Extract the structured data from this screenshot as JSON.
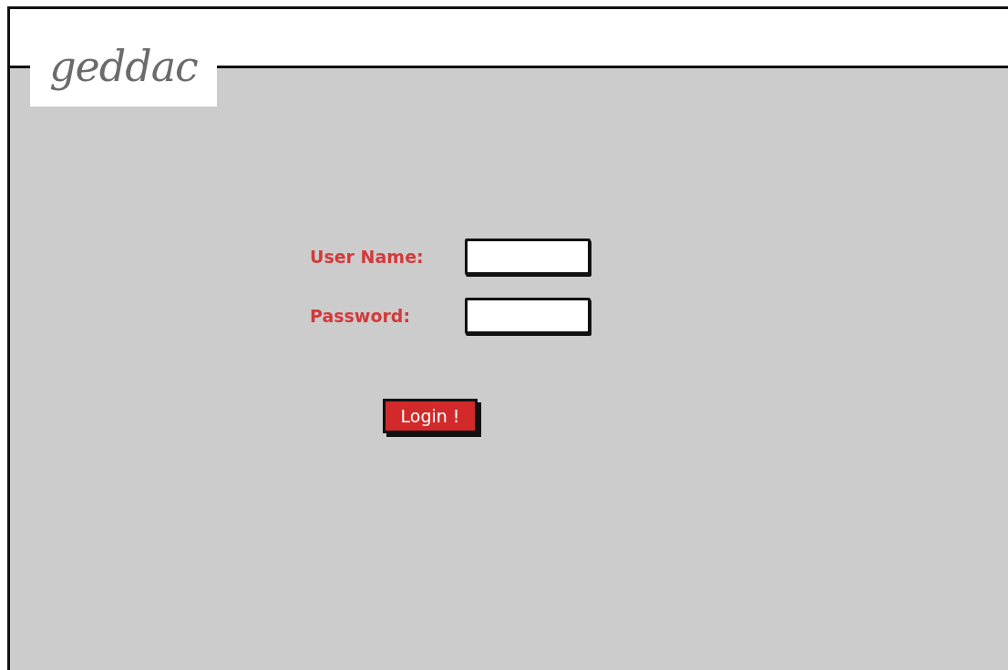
{
  "logo": "geddac",
  "form": {
    "fields": [
      {
        "label": "User Name:"
      },
      {
        "label": "Password:"
      }
    ],
    "submit_button": "Login !"
  }
}
